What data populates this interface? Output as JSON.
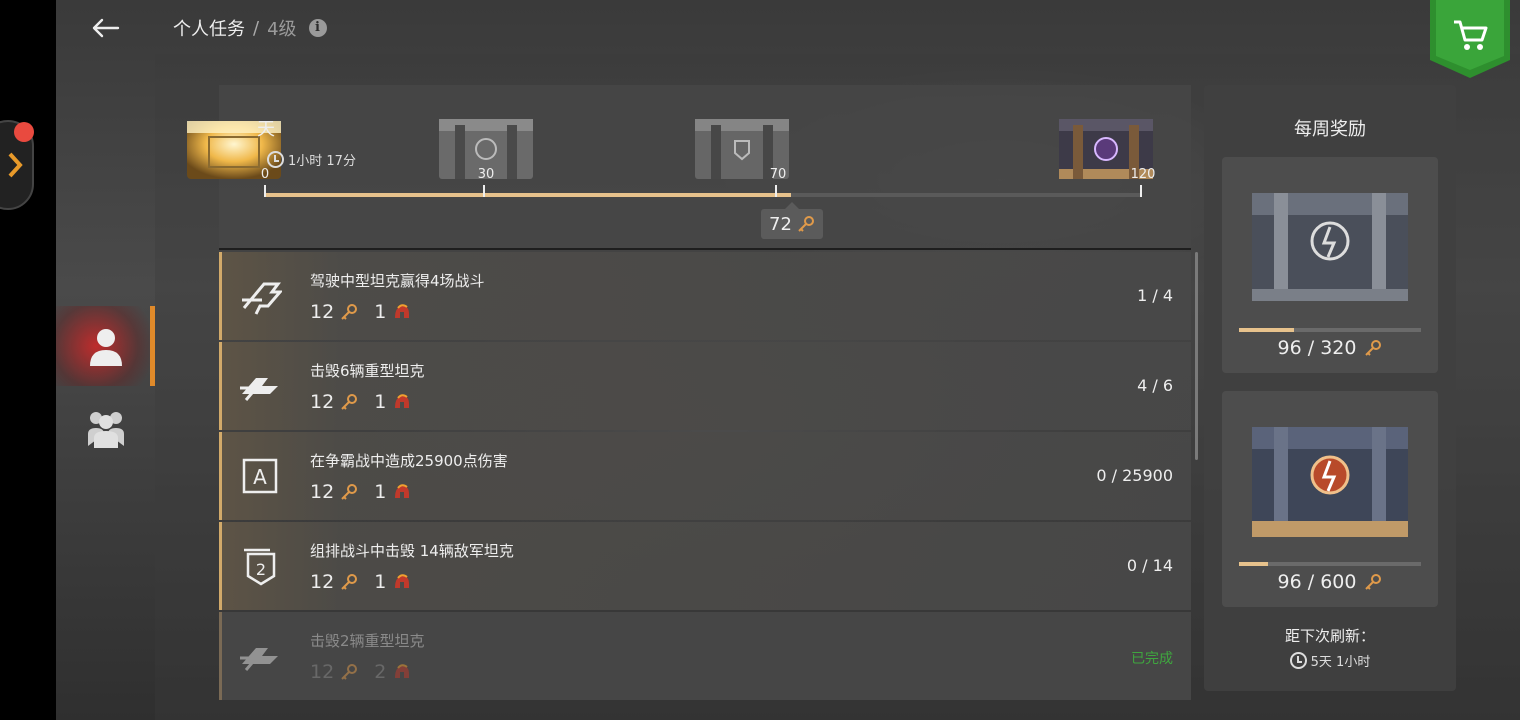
{
  "header": {
    "title": "个人任务",
    "separator": "/",
    "level": "4级",
    "info_icon": "i"
  },
  "progress": {
    "day_label": "天",
    "timer": "1小时 17分",
    "current_points": "72",
    "max_points": 120,
    "milestones": [
      {
        "value": 0,
        "label": "0"
      },
      {
        "value": 30,
        "label": "30"
      },
      {
        "value": 70,
        "label": "70"
      },
      {
        "value": 120,
        "label": "120"
      }
    ],
    "fill_fraction": 0.6
  },
  "missions": [
    {
      "title": "驾驶中型坦克赢得4场战斗",
      "keys": "12",
      "helmets": "1",
      "progress": "1 / 4",
      "icon": "medium-tank-icon",
      "done": false
    },
    {
      "title": "击毁6辆重型坦克",
      "keys": "12",
      "helmets": "1",
      "progress": "4 / 6",
      "icon": "heavy-tank-icon",
      "done": false
    },
    {
      "title": "在争霸战中造成25900点伤害",
      "keys": "12",
      "helmets": "1",
      "progress": "0 / 25900",
      "icon": "supremacy-mode-icon",
      "done": false
    },
    {
      "title": "组排战斗中击毁 14辆敌军坦克",
      "keys": "12",
      "helmets": "1",
      "progress": "0 / 14",
      "icon": "platoon-icon",
      "done": false
    },
    {
      "title": "击毁2辆重型坦克",
      "keys": "12",
      "helmets": "2",
      "progress": "已完成",
      "icon": "heavy-tank-icon",
      "done": true
    }
  ],
  "weekly": {
    "title": "每周奖励",
    "cards": [
      {
        "points": "96 / 320",
        "fraction": 0.3
      },
      {
        "points": "96 / 600",
        "fraction": 0.16
      }
    ],
    "refresh_label": "距下次刷新：",
    "refresh_time": "5天 1小时"
  },
  "colors": {
    "accent": "#e7c28c",
    "nav_active": "#e08a2a",
    "complete": "#3fa63f",
    "cart": "#2e8f2e"
  }
}
